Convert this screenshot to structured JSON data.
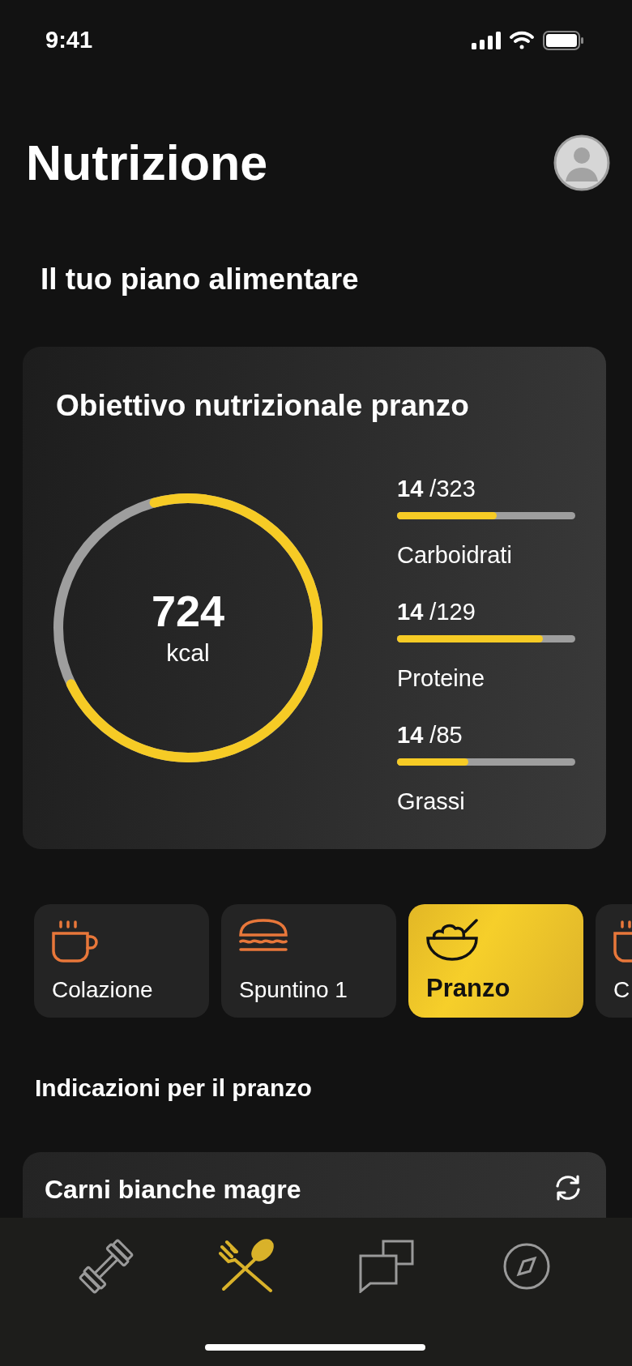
{
  "status_bar": {
    "time": "9:41"
  },
  "header": {
    "title": "Nutrizione"
  },
  "section_title": "Il tuo piano alimentare",
  "goal_card": {
    "title": "Obiettivo nutrizionale pranzo",
    "calories": {
      "value": "724",
      "unit": "kcal",
      "level": 0.72
    },
    "macros": [
      {
        "amount": "**14** /323",
        "name": "Carboidrati",
        "level": 0.56
      },
      {
        "amount": "**14** /129",
        "name": "Proteine",
        "level": 0.82
      },
      {
        "amount": "**14** /85",
        "name": "Grassi",
        "level": 0.4
      }
    ]
  },
  "meals": [
    {
      "label": "Colazione",
      "kind": "cup",
      "selected": false
    },
    {
      "label": "Spuntino 1",
      "kind": "sandwich",
      "selected": false
    },
    {
      "label": "Pranzo",
      "kind": "bowl",
      "selected": true
    },
    {
      "label": "C",
      "kind": "cup",
      "selected": false
    }
  ],
  "guidance": {
    "title": "Indicazioni per il pranzo",
    "items": [
      {
        "name": "Carni bianche magre"
      }
    ]
  },
  "tab_bar": [
    {
      "kind": "dumbbell",
      "selected": false
    },
    {
      "kind": "cutlery",
      "selected": true
    },
    {
      "kind": "chat",
      "selected": false
    },
    {
      "kind": "compass",
      "selected": false
    }
  ]
}
